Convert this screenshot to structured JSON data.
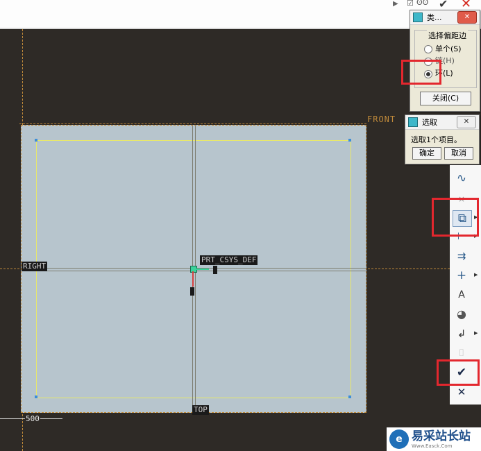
{
  "canvas": {
    "labels": {
      "front": "FRONT",
      "right": "RIGHT",
      "csys": "PRT_CSYS_DEF",
      "top": "TOP",
      "dim": "500"
    }
  },
  "offset_dialog": {
    "title": "类...",
    "group_label": "选择偏距边",
    "options": [
      "单个(S)",
      "链(H)",
      "环(L)"
    ],
    "selected": "环(L)",
    "close_label": "关闭(C)"
  },
  "select_dialog": {
    "title": "选取",
    "message": "选取1个项目。",
    "ok_label": "确定",
    "cancel_label": "取消"
  },
  "toolbar": {
    "tools": [
      "spline-icon",
      "point-icon",
      "offset-edge-icon",
      "dimension-icon",
      "modify-icon",
      "constraint-icon",
      "text-icon",
      "palette-icon",
      "trim-icon",
      "mirror-icon",
      "confirm-icon",
      "cancel-icon"
    ]
  },
  "watermark": {
    "text": "易采站长站",
    "subtext": "Www.Easck.Com"
  },
  "colors": {
    "highlight_box": "#e3272e",
    "sketch_fill": "#b7c5cd",
    "datum": "#c08a3a"
  }
}
